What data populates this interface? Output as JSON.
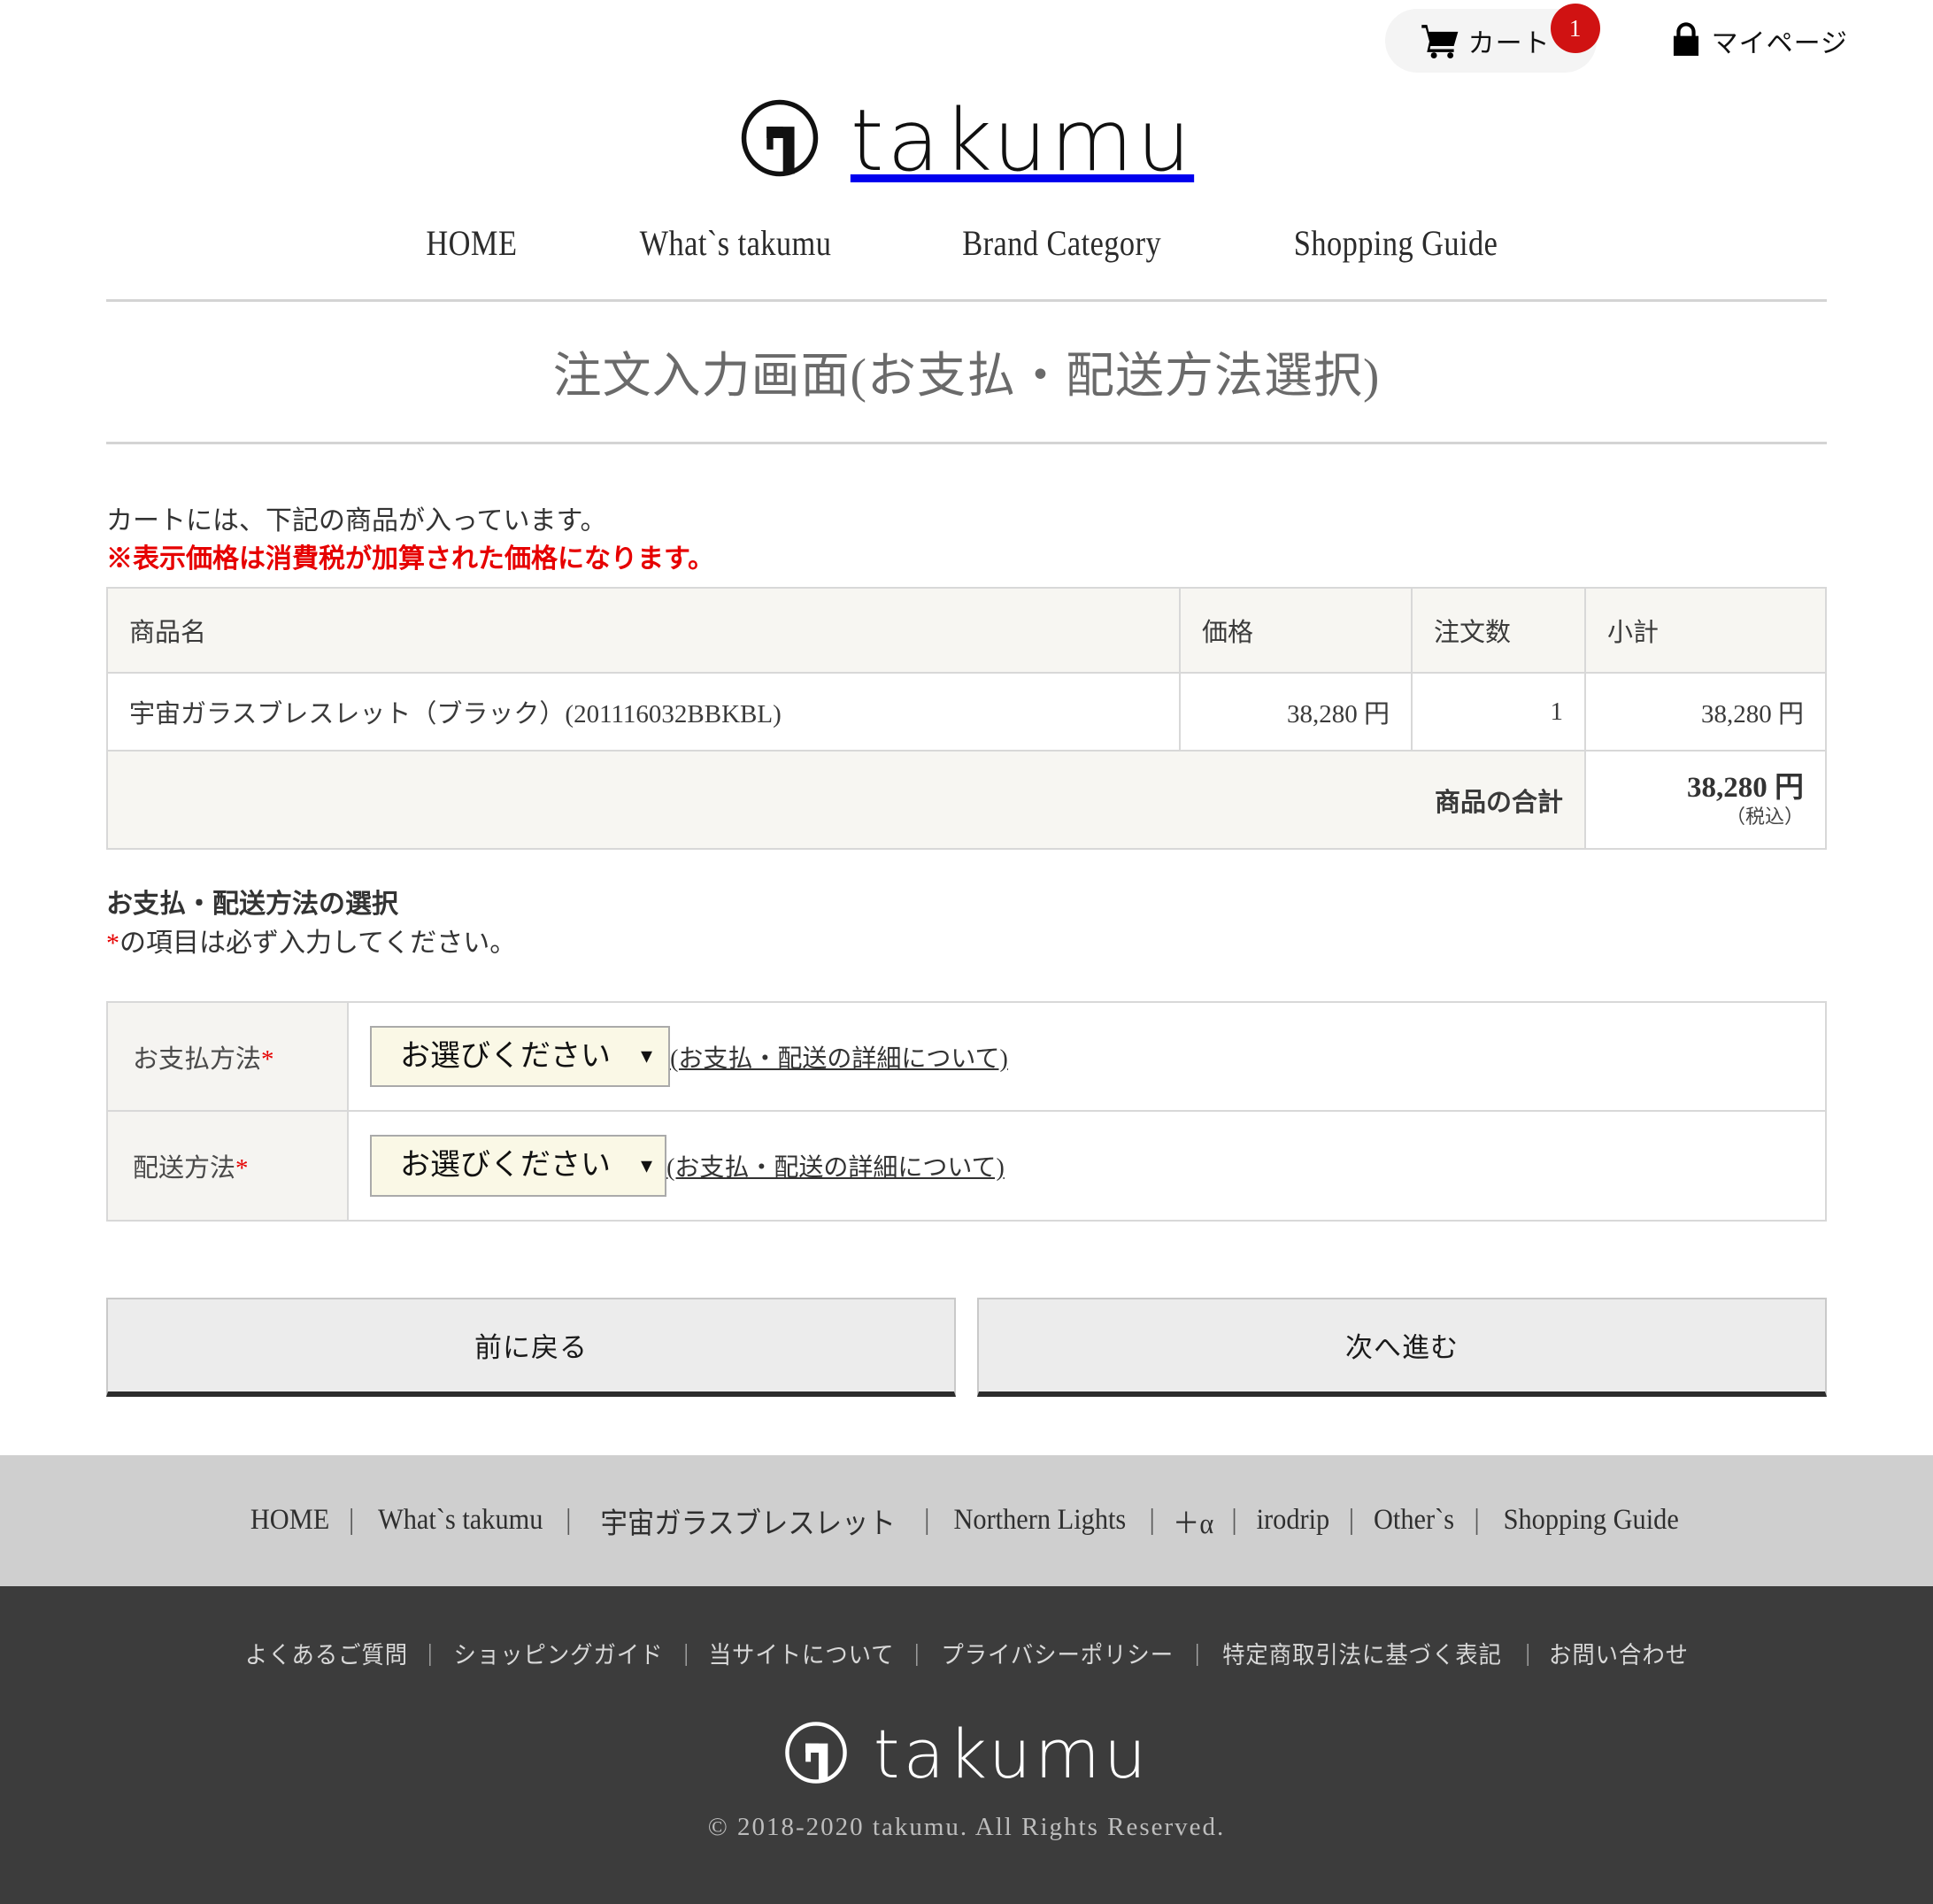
{
  "header": {
    "cart": {
      "label": "カート",
      "badge": "1",
      "icon": "shopping-cart-icon"
    },
    "mypage": {
      "label": "マイページ",
      "icon": "lock-icon"
    },
    "logo": {
      "wordmark": "takumu",
      "icon": "takumu-logo-mark"
    }
  },
  "nav": {
    "items": [
      {
        "label": "HOME"
      },
      {
        "label": "What`s takumu"
      },
      {
        "label": "Brand Category"
      },
      {
        "label": "Shopping Guide"
      }
    ]
  },
  "page": {
    "title": "注文入力画面(お支払・配送方法選択)"
  },
  "cart": {
    "lead": "カートには、下記の商品が入っています。",
    "tax_note": "※表示価格は消費税が加算された価格になります。",
    "columns": [
      "商品名",
      "価格",
      "注文数",
      "小計"
    ],
    "rows": [
      {
        "name": "宇宙ガラスブレスレット（ブラック）(201116032BBKBL)",
        "price": "38,280 円",
        "qty": "1",
        "subtotal": "38,280 円"
      }
    ],
    "total_label": "商品の合計",
    "total_amount": "38,280 円",
    "total_tax_note": "（税込）"
  },
  "selection": {
    "heading": "お支払・配送方法の選択",
    "required_note_mark": "*",
    "required_note": "の項目は必ず入力してください。",
    "payment": {
      "label": "お支払方法",
      "required_mark": "*",
      "select_value": "お選びください",
      "select_options": [
        "お選びください"
      ],
      "detail_link": "(お支払・配送の詳細について)"
    },
    "shipping": {
      "label": "配送方法",
      "required_mark": "*",
      "select_value": "お選びください",
      "select_options": [
        "お選びください"
      ],
      "detail_link": "(お支払・配送の詳細について)"
    }
  },
  "actions": {
    "back_label": "前に戻る",
    "next_label": "次へ進む"
  },
  "footer_nav": {
    "items": [
      {
        "label": "HOME"
      },
      {
        "label": "What`s takumu"
      },
      {
        "label": "宇宙ガラスブレスレット"
      },
      {
        "label": "Northern Lights"
      },
      {
        "label": "＋α"
      },
      {
        "label": "irodrip"
      },
      {
        "label": "Other`s"
      },
      {
        "label": "Shopping Guide"
      }
    ],
    "separator": "|"
  },
  "footer": {
    "links": [
      {
        "label": "よくあるご質問"
      },
      {
        "label": "ショッピングガイド"
      },
      {
        "label": "当サイトについて"
      },
      {
        "label": "プライバシーポリシー"
      },
      {
        "label": "特定商取引法に基づく表記"
      },
      {
        "label": "お問い合わせ"
      }
    ],
    "separator": "|",
    "logo_wordmark": "takumu",
    "copyright": "© 2018-2020 takumu. All Rights Reserved."
  },
  "colors": {
    "badge_red": "#d01212",
    "note_red": "#e60000",
    "select_bg": "#faf8e6",
    "footer_nav_bg": "#cfcfcf",
    "footer_dark_bg": "#3c3c3c"
  }
}
